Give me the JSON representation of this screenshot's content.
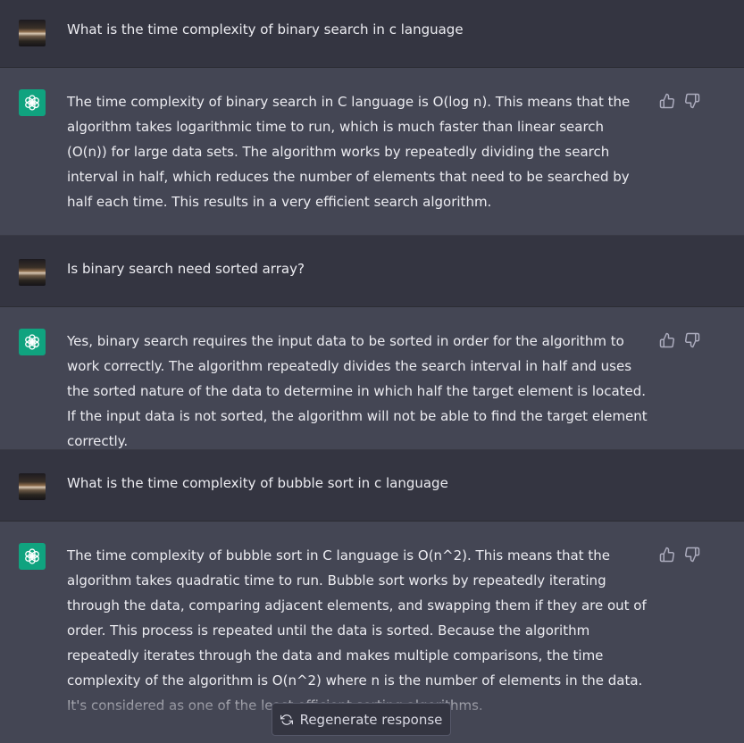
{
  "conversation": [
    {
      "role": "user",
      "text": "What is the time complexity of binary search in c language"
    },
    {
      "role": "assistant",
      "text": "The time complexity of binary search in C language is O(log n). This means that the algorithm takes logarithmic time to run, which is much faster than linear search (O(n)) for large data sets. The algorithm works by repeatedly dividing the search interval in half, which reduces the number of elements that need to be searched by half each time. This results in a very efficient search algorithm."
    },
    {
      "role": "user",
      "text": "Is binary search need sorted array?"
    },
    {
      "role": "assistant",
      "text": "Yes, binary search requires the input data to be sorted in order for the algorithm to work correctly. The algorithm repeatedly divides the search interval in half and uses the sorted nature of the data to determine in which half the target element is located. If the input data is not sorted, the algorithm will not be able to find the target element correctly."
    },
    {
      "role": "user",
      "text": "What is the time complexity of bubble sort in c language"
    },
    {
      "role": "assistant",
      "text": "The time complexity of bubble sort in C language is O(n^2). This means that the algorithm takes quadratic time to run. Bubble sort works by repeatedly iterating through the data, comparing adjacent elements, and swapping them if they are out of order. This process is repeated until the data is sorted. Because the algorithm repeatedly iterates through the data and makes multiple comparisons, the time complexity of the algorithm is O(n^2) where n is the number of elements in the data. It's considered as one of the least efficient sorting algorithms."
    }
  ],
  "icons": {
    "user_avatar": "user-avatar",
    "assistant_avatar": "openai-logo-icon",
    "thumbs_up": "thumbs-up-icon",
    "thumbs_down": "thumbs-down-icon",
    "regenerate": "refresh-icon"
  },
  "regenerate_label": "Regenerate response",
  "colors": {
    "user_row_bg": "#343541",
    "assistant_row_bg": "#444654",
    "assistant_avatar_bg": "#10a37f",
    "text": "#ececf1"
  }
}
